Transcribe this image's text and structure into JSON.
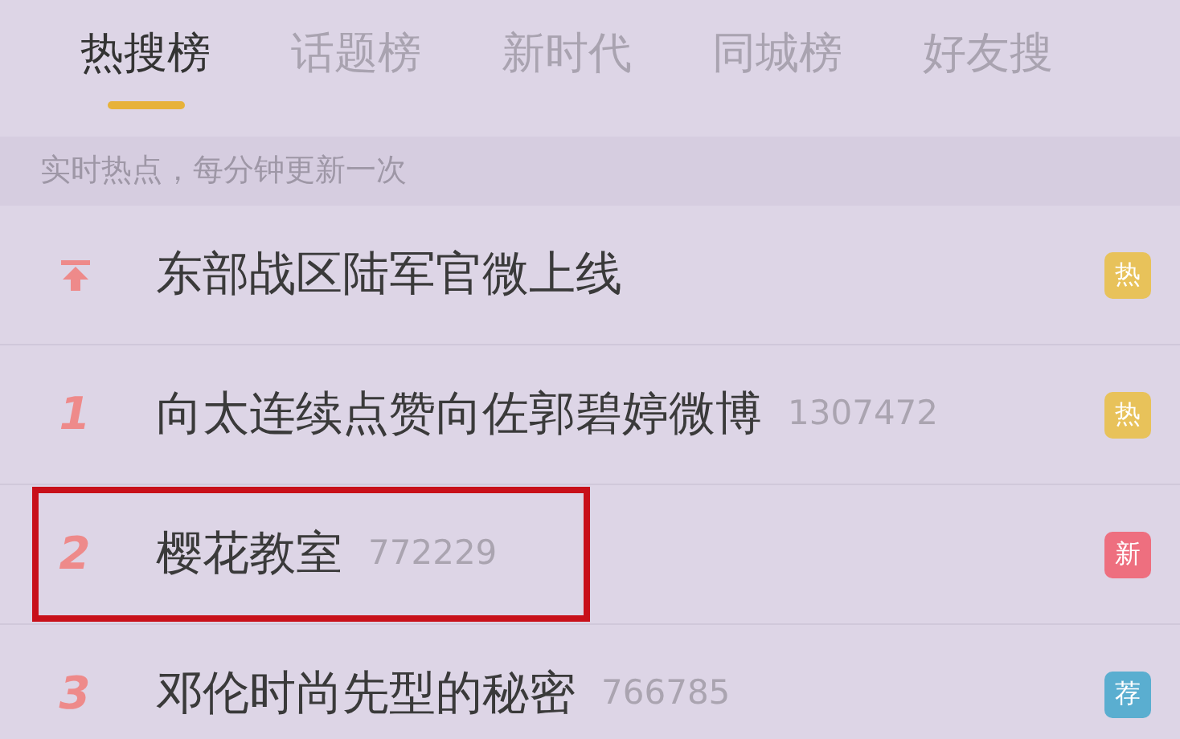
{
  "tabs": [
    {
      "label": "热搜榜",
      "selected": true
    },
    {
      "label": "话题榜",
      "selected": false
    },
    {
      "label": "新时代",
      "selected": false
    },
    {
      "label": "同城榜",
      "selected": false
    },
    {
      "label": "好友搜",
      "selected": false
    }
  ],
  "subtitle": "实时热点，每分钟更新一次",
  "rows": [
    {
      "kind": "pinned",
      "title": "东部战区陆军官微上线",
      "badge": "热",
      "color": "#e8c25a",
      "highlighted": false
    },
    {
      "kind": "ranked",
      "rank": "1",
      "title": "向太连续点赞向佐郭碧婷微博",
      "count": "1307472",
      "badge": "热",
      "color": "#e8c25a",
      "highlighted": false
    },
    {
      "kind": "ranked",
      "rank": "2",
      "title": "樱花教室",
      "count": "772229",
      "badge": "新",
      "color": "#ee6f7f",
      "highlighted": true
    },
    {
      "kind": "ranked",
      "rank": "3",
      "title": "邓伦时尚先型的秘密",
      "count": "766785",
      "badge": "荐",
      "color": "#5aaed0",
      "highlighted": false
    }
  ]
}
